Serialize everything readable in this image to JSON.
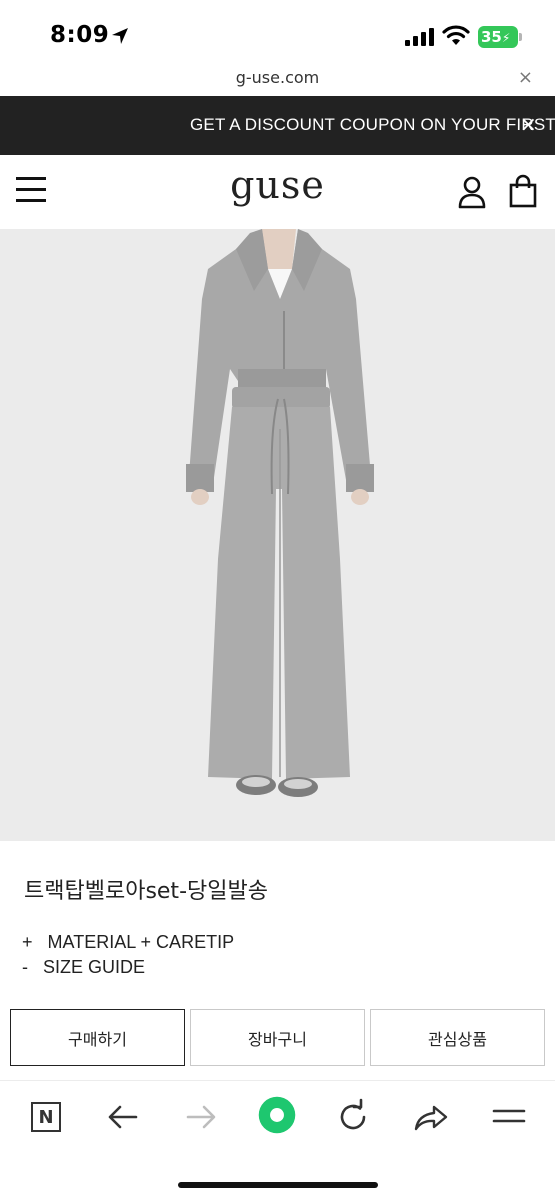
{
  "status_bar": {
    "time": "8:09",
    "battery": "35"
  },
  "url_bar": {
    "domain": "g-use.com",
    "close_label": "×"
  },
  "promo": {
    "text": "GET A DISCOUNT COUPON ON YOUR FIRST O",
    "close_label": "×"
  },
  "header": {
    "logo": "guse"
  },
  "product": {
    "title": "트랙탑벨로아set-당일발송",
    "info_lines": [
      {
        "prefix": "+",
        "text": "MATERIAL + CARETIP"
      },
      {
        "prefix": "-",
        "text": "SIZE GUIDE"
      }
    ]
  },
  "actions": {
    "buy": "구매하기",
    "cart": "장바구니",
    "wishlist": "관심상품"
  },
  "colors": {
    "promo_bg": "#222222",
    "battery": "#34c759",
    "browser_accent": "#1ec76f",
    "image_bg": "#ebebeb"
  },
  "toolbar": {
    "icons": [
      "naver-n-icon",
      "back-arrow-icon",
      "forward-arrow-icon",
      "green-dot-icon",
      "refresh-icon",
      "share-icon",
      "menu-icon"
    ],
    "n_label": "N"
  }
}
